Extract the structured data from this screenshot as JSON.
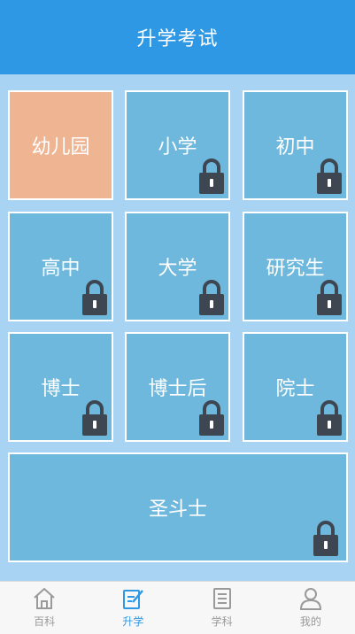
{
  "header": {
    "title": "升学考试"
  },
  "tiles": [
    {
      "label": "幼儿园",
      "locked": false
    },
    {
      "label": "小学",
      "locked": true
    },
    {
      "label": "初中",
      "locked": true
    },
    {
      "label": "高中",
      "locked": true
    },
    {
      "label": "大学",
      "locked": true
    },
    {
      "label": "研究生",
      "locked": true
    },
    {
      "label": "博士",
      "locked": true
    },
    {
      "label": "博士后",
      "locked": true
    },
    {
      "label": "院士",
      "locked": true
    },
    {
      "label": "圣斗士",
      "locked": true
    }
  ],
  "tabbar": {
    "items": [
      {
        "label": "百科",
        "icon": "home-icon",
        "active": false
      },
      {
        "label": "升学",
        "icon": "edit-icon",
        "active": true
      },
      {
        "label": "学科",
        "icon": "book-icon",
        "active": false
      },
      {
        "label": "我的",
        "icon": "user-icon",
        "active": false
      }
    ]
  },
  "colors": {
    "header": "#2f98e4",
    "background": "#a9d3f2",
    "tile": "#6db8dc",
    "tile_unlocked": "#efb593",
    "tab_active": "#2f98e4",
    "tab_inactive": "#9a9a9a"
  }
}
